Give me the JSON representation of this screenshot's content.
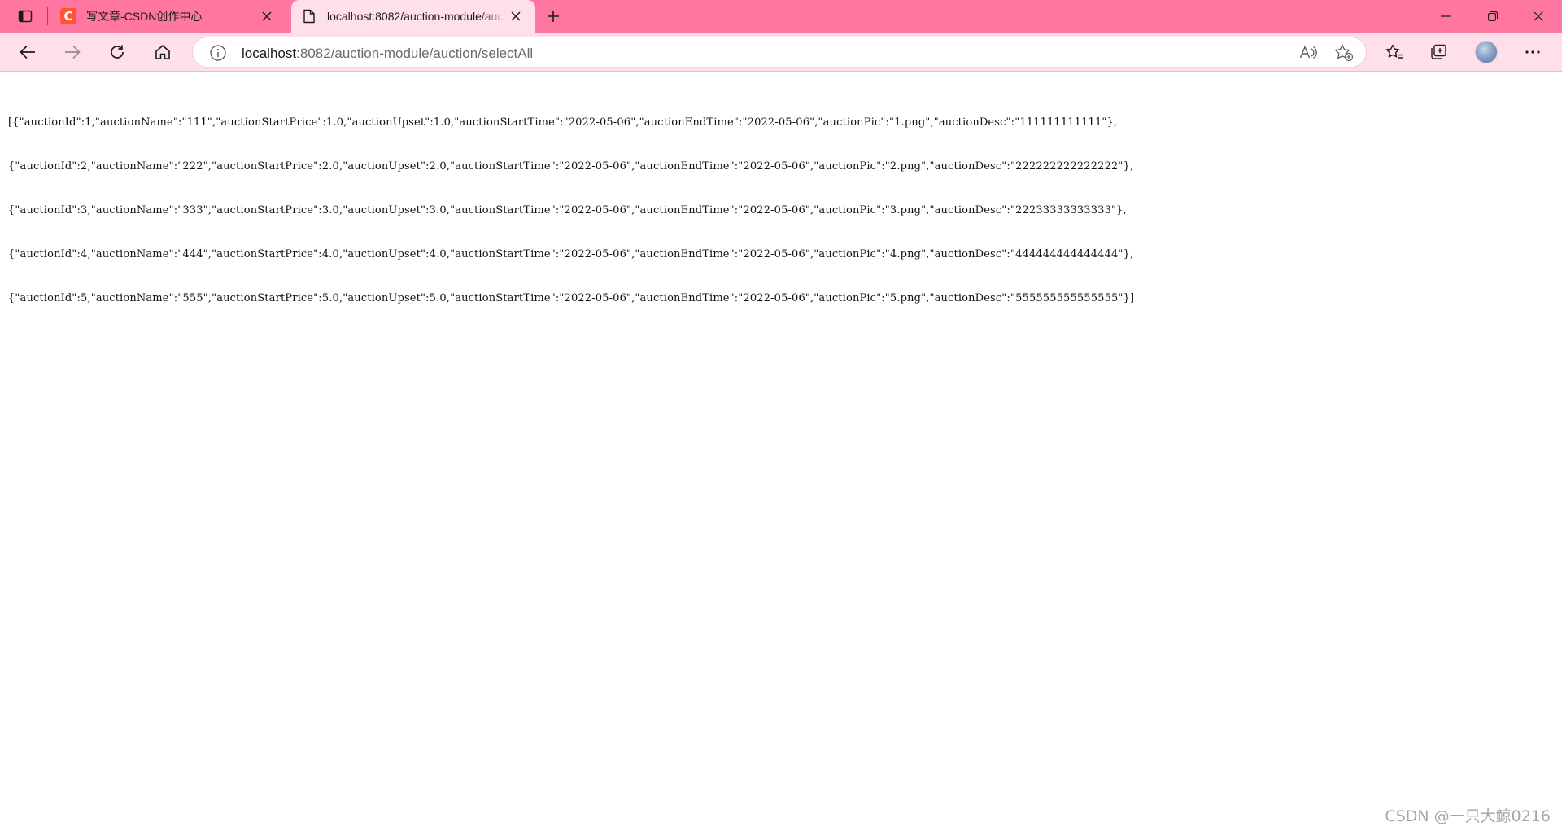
{
  "browser": {
    "tabs": [
      {
        "title": "写文章-CSDN创作中心",
        "favicon": "csdn-logo",
        "active": false
      },
      {
        "title": "localhost:8082/auction-module/auction/selectAll",
        "favicon": "page-icon",
        "active": true
      }
    ],
    "address": {
      "host": "localhost",
      "path": ":8082/auction-module/auction/selectAll"
    },
    "colors": {
      "tabbar": "#ff77a1",
      "toolbar": "#ffe0ea"
    }
  },
  "content": {
    "json_lines": [
      "[{\"auctionId\":1,\"auctionName\":\"111\",\"auctionStartPrice\":1.0,\"auctionUpset\":1.0,\"auctionStartTime\":\"2022-05-06\",\"auctionEndTime\":\"2022-05-06\",\"auctionPic\":\"1.png\",\"auctionDesc\":\"111111111111\"},",
      "{\"auctionId\":2,\"auctionName\":\"222\",\"auctionStartPrice\":2.0,\"auctionUpset\":2.0,\"auctionStartTime\":\"2022-05-06\",\"auctionEndTime\":\"2022-05-06\",\"auctionPic\":\"2.png\",\"auctionDesc\":\"222222222222222\"},",
      "{\"auctionId\":3,\"auctionName\":\"333\",\"auctionStartPrice\":3.0,\"auctionUpset\":3.0,\"auctionStartTime\":\"2022-05-06\",\"auctionEndTime\":\"2022-05-06\",\"auctionPic\":\"3.png\",\"auctionDesc\":\"22233333333333\"},",
      "{\"auctionId\":4,\"auctionName\":\"444\",\"auctionStartPrice\":4.0,\"auctionUpset\":4.0,\"auctionStartTime\":\"2022-05-06\",\"auctionEndTime\":\"2022-05-06\",\"auctionPic\":\"4.png\",\"auctionDesc\":\"444444444444444\"},",
      "{\"auctionId\":5,\"auctionName\":\"555\",\"auctionStartPrice\":5.0,\"auctionUpset\":5.0,\"auctionStartTime\":\"2022-05-06\",\"auctionEndTime\":\"2022-05-06\",\"auctionPic\":\"5.png\",\"auctionDesc\":\"555555555555555\"}]"
    ],
    "watermark": "CSDN @一只大鲸0216"
  }
}
